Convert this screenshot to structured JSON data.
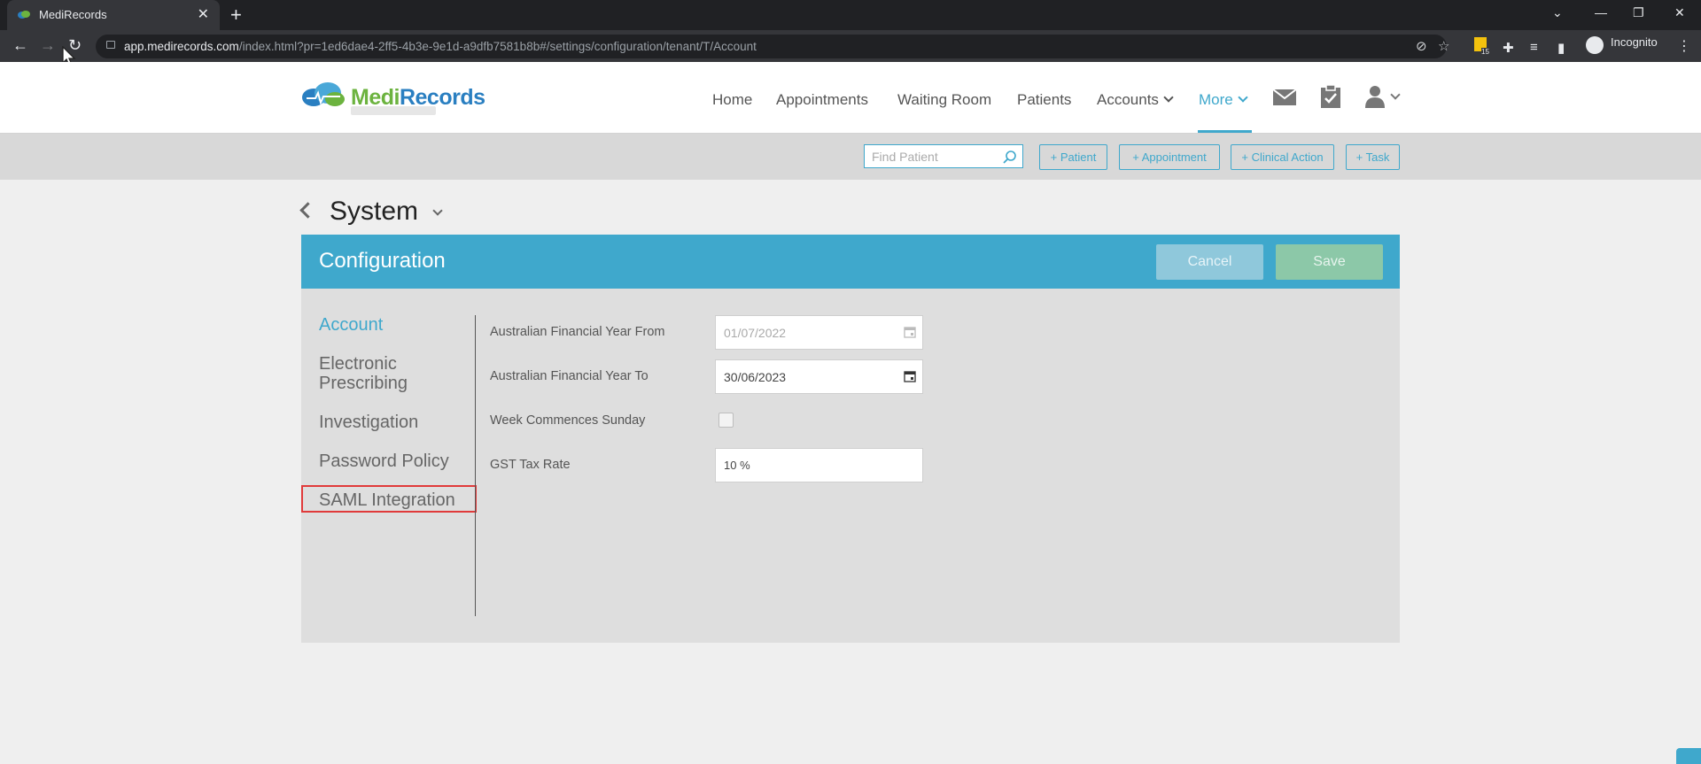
{
  "browser": {
    "tab_title": "MediRecords",
    "url_host": "app.medirecords.com",
    "url_path": "/index.html?pr=1ed6dae4-2ff5-4b3e-9e1d-a9dfb7581b8b#/settings/configuration/tenant/T/Account",
    "incognito_label": "Incognito",
    "extension_badge": "15"
  },
  "header": {
    "logo_medi": "Medi",
    "logo_records": "Records",
    "nav": {
      "home": "Home",
      "appointments": "Appointments",
      "waiting_room": "Waiting Room",
      "patients": "Patients",
      "accounts": "Accounts",
      "more": "More"
    }
  },
  "actionbar": {
    "find_placeholder": "Find Patient",
    "add_patient": "+ Patient",
    "add_appointment": "+ Appointment",
    "add_clinical_action": "+ Clinical Action",
    "add_task": "+ Task"
  },
  "page": {
    "title": "System",
    "panel_title": "Configuration",
    "cancel": "Cancel",
    "save": "Save"
  },
  "sidebar": {
    "items": [
      {
        "label": "Account"
      },
      {
        "label": "Electronic Prescribing"
      },
      {
        "label": "Investigation"
      },
      {
        "label": "Password Policy"
      },
      {
        "label": "SAML Integration"
      }
    ]
  },
  "form": {
    "fy_from_label": "Australian Financial Year From",
    "fy_from_value": "01/07/2022",
    "fy_to_label": "Australian Financial Year To",
    "fy_to_value": "30/06/2023",
    "week_sunday_label": "Week Commences Sunday",
    "gst_label": "GST Tax Rate",
    "gst_value": "10 %"
  },
  "colors": {
    "accent": "#3fa8cc",
    "save": "#8cc8a8",
    "highlight": "#e03a3a"
  }
}
